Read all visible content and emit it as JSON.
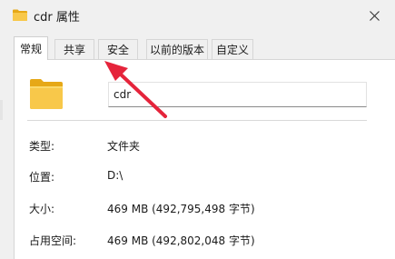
{
  "window": {
    "title": "cdr 属性",
    "folder_icon": "folder-icon",
    "close_icon": "close-icon"
  },
  "tabs": [
    {
      "label": "常规",
      "active": true
    },
    {
      "label": "共享",
      "active": false
    },
    {
      "label": "安全",
      "active": false
    },
    {
      "label": "以前的版本",
      "active": false
    },
    {
      "label": "自定义",
      "active": false
    }
  ],
  "general": {
    "name_value": "cdr",
    "rows": [
      {
        "label": "类型:",
        "value": "文件夹"
      },
      {
        "label": "位置:",
        "value": "D:\\"
      },
      {
        "label": "大小:",
        "value": "469 MB (492,795,498 字节)"
      },
      {
        "label": "占用空间:",
        "value": "469 MB (492,802,048 字节)"
      }
    ]
  },
  "colors": {
    "folder": "#f5c342",
    "folder_light": "#fbd96b",
    "arrow": "#e5243b",
    "background": "#f0f0f0"
  }
}
